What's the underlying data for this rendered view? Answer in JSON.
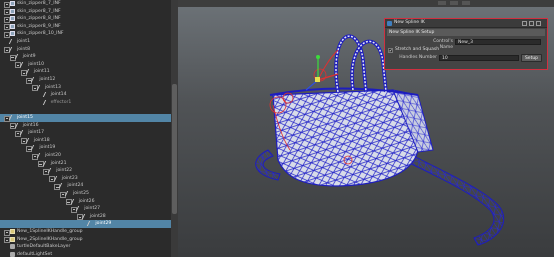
{
  "outliner": {
    "rows": [
      {
        "label": "skin_zipper8_7_INF",
        "icon": "mesh",
        "indent": 0,
        "expander": true
      },
      {
        "label": "skin_zipper8_7_INF",
        "icon": "mesh",
        "indent": 0,
        "expander": true
      },
      {
        "label": "skin_zipper8_8_INF",
        "icon": "mesh",
        "indent": 0,
        "expander": true
      },
      {
        "label": "skin_zipper8_9_INF",
        "icon": "mesh",
        "indent": 0,
        "expander": true
      },
      {
        "label": "skin_zipper8_10_INF",
        "icon": "mesh",
        "indent": 0,
        "expander": true
      },
      {
        "label": "joint1",
        "icon": "joint",
        "indent": 0,
        "expander": false
      },
      {
        "label": "joint8",
        "icon": "joint",
        "indent": 0,
        "expander": true
      },
      {
        "label": "joint9",
        "icon": "joint",
        "indent": 1,
        "expander": true
      },
      {
        "label": "joint10",
        "icon": "joint",
        "indent": 2,
        "expander": true
      },
      {
        "label": "joint11",
        "icon": "joint",
        "indent": 3,
        "expander": true
      },
      {
        "label": "joint12",
        "icon": "joint",
        "indent": 4,
        "expander": true
      },
      {
        "label": "joint13",
        "icon": "joint",
        "indent": 5,
        "expander": true
      },
      {
        "label": "joint14",
        "icon": "joint",
        "indent": 6,
        "expander": false
      },
      {
        "label": "effector1",
        "icon": "joint",
        "indent": 6,
        "expander": false,
        "dim": true
      },
      {
        "label": "",
        "icon": "none",
        "indent": 0,
        "expander": false
      },
      {
        "label": "joint15",
        "icon": "joint",
        "indent": 0,
        "expander": true,
        "selected": true
      },
      {
        "label": "joint16",
        "icon": "joint",
        "indent": 1,
        "expander": true
      },
      {
        "label": "joint17",
        "icon": "joint",
        "indent": 2,
        "expander": true
      },
      {
        "label": "joint18",
        "icon": "joint",
        "indent": 3,
        "expander": true
      },
      {
        "label": "joint19",
        "icon": "joint",
        "indent": 4,
        "expander": true
      },
      {
        "label": "joint20",
        "icon": "joint",
        "indent": 5,
        "expander": true
      },
      {
        "label": "joint21",
        "icon": "joint",
        "indent": 6,
        "expander": true
      },
      {
        "label": "joint22",
        "icon": "joint",
        "indent": 7,
        "expander": true
      },
      {
        "label": "joint23",
        "icon": "joint",
        "indent": 8,
        "expander": true
      },
      {
        "label": "joint24",
        "icon": "joint",
        "indent": 9,
        "expander": true
      },
      {
        "label": "joint25",
        "icon": "joint",
        "indent": 10,
        "expander": true
      },
      {
        "label": "joint26",
        "icon": "joint",
        "indent": 11,
        "expander": true
      },
      {
        "label": "joint27",
        "icon": "joint",
        "indent": 12,
        "expander": true
      },
      {
        "label": "joint28",
        "icon": "joint",
        "indent": 13,
        "expander": true
      },
      {
        "label": "joint29",
        "icon": "joint",
        "indent": 14,
        "expander": false,
        "selected": true
      },
      {
        "label": "New_1SplineIKHandle_group",
        "icon": "grp",
        "indent": 0,
        "expander": true
      },
      {
        "label": "New_2SplineIKHandle_group",
        "icon": "grp",
        "indent": 0,
        "expander": true
      },
      {
        "label": "turtleDefaultBakeLayer",
        "icon": "layer",
        "indent": 0,
        "expander": false
      },
      {
        "label": "defaultLightSet",
        "icon": "layer",
        "indent": 0,
        "expander": false
      }
    ]
  },
  "dialog": {
    "title": "New Spline IK",
    "section": "New Spline IK Setup",
    "controls_name_label": "Control's Name",
    "controls_name_value": "New_3",
    "stretch_label": "Stretch and Squash",
    "stretch_checked": true,
    "check_mark": "✔",
    "handles_label": "Handles Number",
    "handles_value": "10",
    "setup_label": "Setup"
  },
  "colors": {
    "selection": "#5285a6",
    "wireframe": "#1d1dbf",
    "dialog_highlight": "#d03040"
  }
}
